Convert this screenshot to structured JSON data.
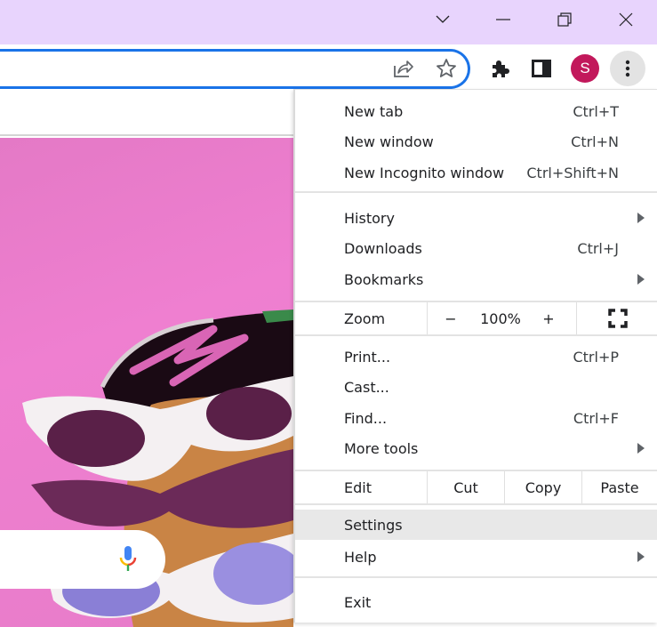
{
  "window": {
    "controls": {
      "tab_search": "tab-search-chevron",
      "minimize": "minimize",
      "restore": "restore",
      "close": "close"
    }
  },
  "toolbar": {
    "share_icon": "share",
    "bookmark_icon": "star",
    "extensions_icon": "puzzle-piece",
    "side_panel_icon": "side-panel",
    "profile_initial": "S",
    "profile_color": "#c2185b",
    "menu_icon": "vertical-dots",
    "omnibox_border_color": "#1a73e8"
  },
  "page": {
    "search_mic_icon": "google-mic"
  },
  "menu": {
    "group1": [
      {
        "label": "New tab",
        "shortcut": "Ctrl+T"
      },
      {
        "label": "New window",
        "shortcut": "Ctrl+N"
      },
      {
        "label": "New Incognito window",
        "shortcut": "Ctrl+Shift+N"
      }
    ],
    "group2": [
      {
        "label": "History",
        "submenu": true
      },
      {
        "label": "Downloads",
        "shortcut": "Ctrl+J"
      },
      {
        "label": "Bookmarks",
        "submenu": true
      }
    ],
    "zoom": {
      "label": "Zoom",
      "minus": "−",
      "value": "100%",
      "plus": "+",
      "fullscreen_icon": "fullscreen"
    },
    "group3": [
      {
        "label": "Print...",
        "shortcut": "Ctrl+P"
      },
      {
        "label": "Cast..."
      },
      {
        "label": "Find...",
        "shortcut": "Ctrl+F"
      },
      {
        "label": "More tools",
        "submenu": true
      }
    ],
    "edit": {
      "label": "Edit",
      "cut": "Cut",
      "copy": "Copy",
      "paste": "Paste"
    },
    "group4": [
      {
        "label": "Settings",
        "highlighted": true
      },
      {
        "label": "Help",
        "submenu": true
      }
    ],
    "group5": [
      {
        "label": "Exit"
      }
    ]
  }
}
